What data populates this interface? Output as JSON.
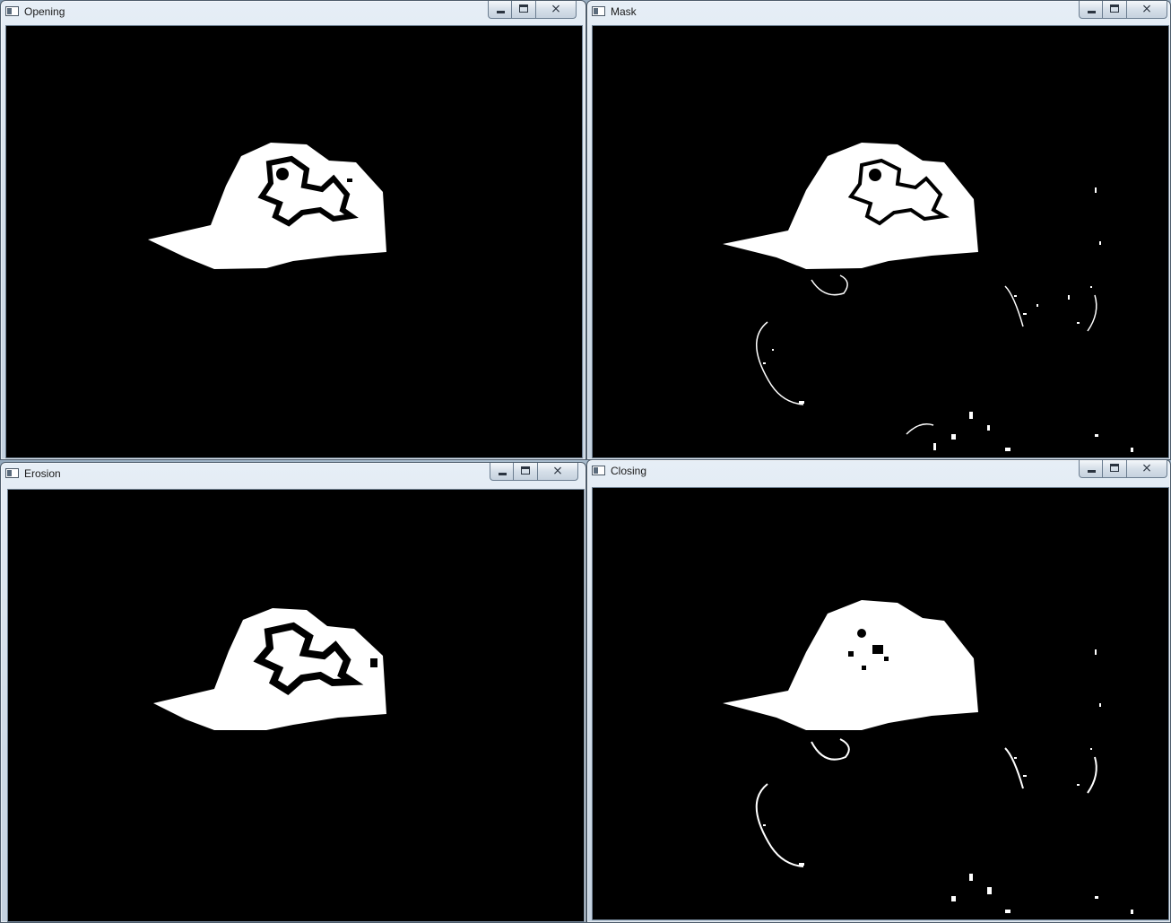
{
  "windows": {
    "opening": {
      "title": "Opening",
      "close_glyph": "⨯",
      "icon": "opencv-window-icon"
    },
    "mask": {
      "title": "Mask",
      "close_glyph": "⨯",
      "icon": "opencv-window-icon"
    },
    "erosion": {
      "title": "Erosion",
      "close_glyph": "⨯",
      "icon": "opencv-window-icon"
    },
    "closing": {
      "title": "Closing",
      "close_glyph": "⨯",
      "icon": "opencv-window-icon"
    }
  },
  "colors": {
    "image_background": "#000000",
    "mask_foreground": "#ffffff",
    "titlebar": "#d6e1ec"
  }
}
